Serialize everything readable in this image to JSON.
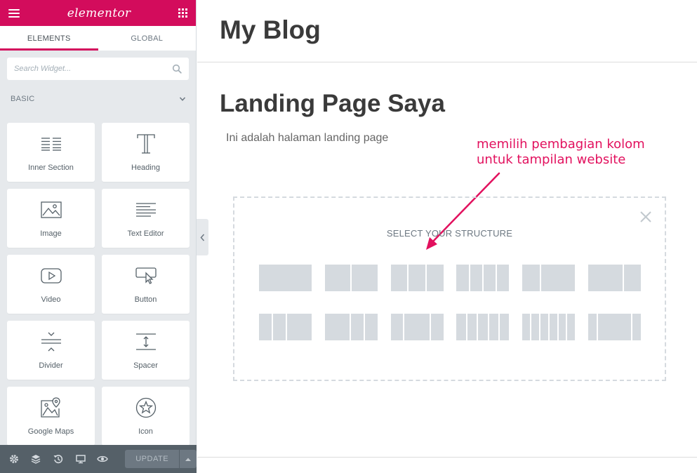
{
  "panel": {
    "logo": "elementor",
    "tabs": [
      {
        "label": "ELEMENTS",
        "active": true
      },
      {
        "label": "GLOBAL",
        "active": false
      }
    ],
    "search": {
      "placeholder": "Search Widget..."
    },
    "category": "BASIC",
    "widgets": [
      {
        "label": "Inner Section",
        "icon": "inner-section-icon"
      },
      {
        "label": "Heading",
        "icon": "heading-icon"
      },
      {
        "label": "Image",
        "icon": "image-icon"
      },
      {
        "label": "Text Editor",
        "icon": "text-editor-icon"
      },
      {
        "label": "Video",
        "icon": "video-icon"
      },
      {
        "label": "Button",
        "icon": "button-icon"
      },
      {
        "label": "Divider",
        "icon": "divider-icon"
      },
      {
        "label": "Spacer",
        "icon": "spacer-icon"
      },
      {
        "label": "Google Maps",
        "icon": "google-maps-icon"
      },
      {
        "label": "Icon",
        "icon": "star-icon"
      }
    ],
    "footer": {
      "update_label": "UPDATE",
      "icons": [
        "settings-icon",
        "navigator-icon",
        "history-icon",
        "responsive-icon",
        "preview-icon"
      ]
    }
  },
  "canvas": {
    "site_title": "My Blog",
    "page_title": "Landing Page Saya",
    "page_text": "Ini adalah halaman landing page",
    "annotation": [
      "memilih pembagian kolom",
      "untuk tampilan website"
    ],
    "structure": {
      "title": "SELECT YOUR STRUCTURE",
      "presets_row1": [
        [
          100
        ],
        [
          50,
          50
        ],
        [
          33,
          33,
          33
        ],
        [
          25,
          25,
          25,
          25
        ],
        [
          33,
          66
        ],
        [
          66,
          33
        ]
      ],
      "presets_row2": [
        [
          25,
          25,
          50
        ],
        [
          50,
          25,
          25
        ],
        [
          25,
          50,
          25
        ],
        [
          20,
          20,
          20,
          20,
          20
        ],
        [
          16,
          16,
          16,
          16,
          16,
          16
        ],
        [
          16,
          66,
          16
        ]
      ]
    }
  },
  "colors": {
    "brand": "#d30c5c",
    "annotation": "#e2115e",
    "panel_bg": "#e6e9ec",
    "footer_bg": "#556068"
  }
}
